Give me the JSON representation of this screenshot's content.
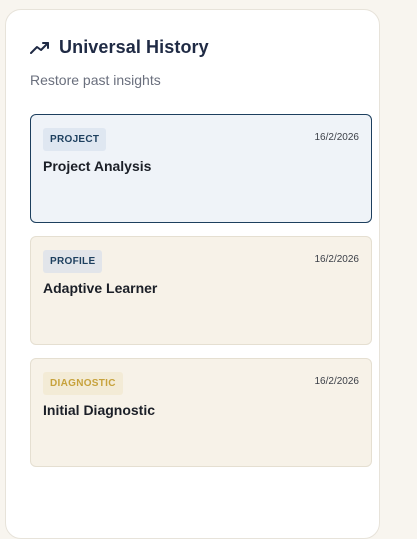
{
  "header": {
    "icon": "trending-up-icon",
    "title": "Universal History",
    "subtitle": "Restore past insights"
  },
  "colors": {
    "title": "#1f2a44",
    "active_border": "#1d3f5e",
    "panel_bg": "#ffffff",
    "page_bg": "#f8f5ef"
  },
  "history": [
    {
      "badge": "PROJECT",
      "badge_color": "#1d3f5e",
      "badge_bg": "#dfe7f1",
      "date": "16/2/2026",
      "title": "Project Analysis",
      "selected": true
    },
    {
      "badge": "PROFILE",
      "badge_color": "#1d3f5e",
      "badge_bg": "#e2e5ea",
      "date": "16/2/2026",
      "title": "Adaptive Learner",
      "selected": false
    },
    {
      "badge": "DIAGNOSTIC",
      "badge_color": "#c7a23c",
      "badge_bg": "#f3ebd6",
      "date": "16/2/2026",
      "title": "Initial Diagnostic",
      "selected": false
    }
  ]
}
